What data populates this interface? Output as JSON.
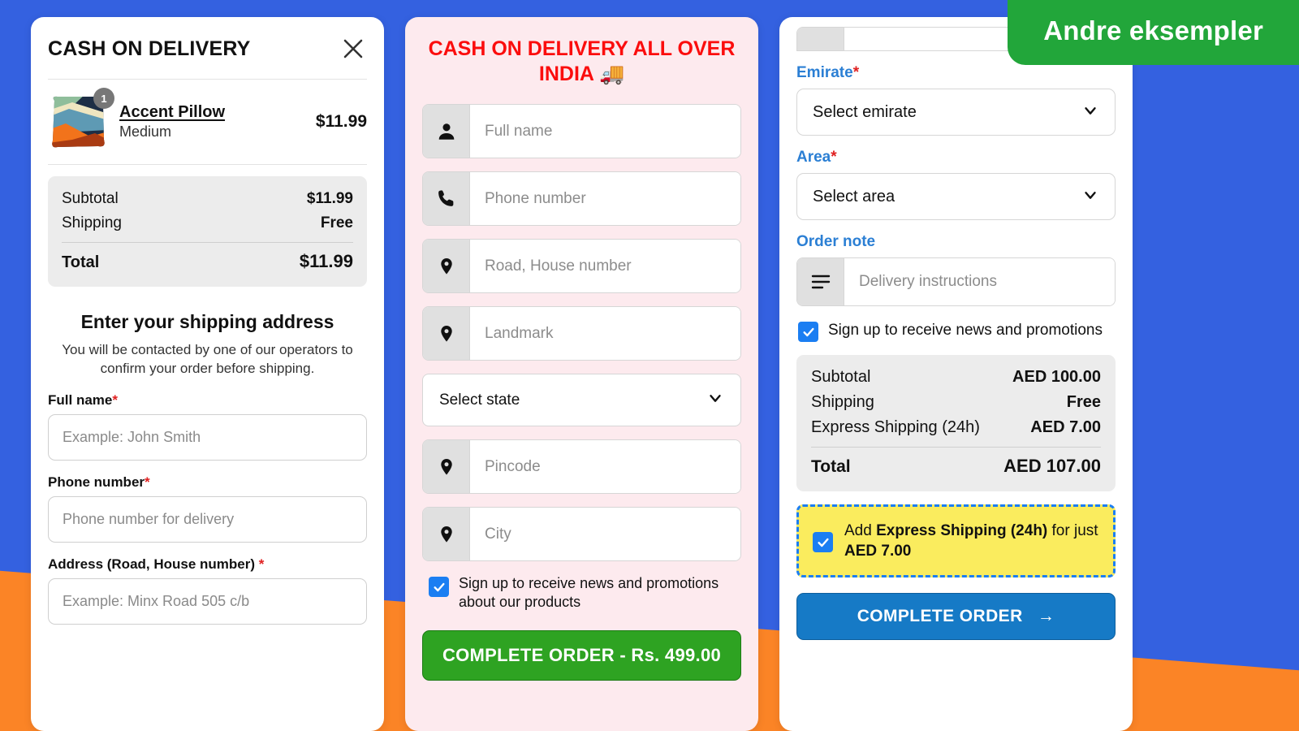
{
  "badge": {
    "label": "Andre eksempler"
  },
  "card1": {
    "title": "CASH ON DELIVERY",
    "close_icon": "close-icon",
    "line_item": {
      "qty": "1",
      "name": "Accent Pillow",
      "variant": "Medium",
      "price": "$11.99"
    },
    "summary": {
      "rows": [
        {
          "label": "Subtotal",
          "value": "$11.99"
        },
        {
          "label": "Shipping",
          "value": "Free"
        }
      ],
      "total_label": "Total",
      "total_value": "$11.99"
    },
    "shipping_heading": "Enter your shipping address",
    "shipping_note": "You will be contacted by one of our operators to confirm your order before shipping.",
    "fields": [
      {
        "label": "Full name",
        "required": "*",
        "placeholder": "Example: John Smith",
        "value": ""
      },
      {
        "label": "Phone number",
        "required": "*",
        "placeholder": "Phone number for delivery",
        "value": ""
      },
      {
        "label": "Address (Road, House number)",
        "required": "*",
        "placeholder": "Example: Minx Road 505 c/b",
        "value": ""
      }
    ]
  },
  "card2": {
    "title": "CASH ON DELIVERY ALL OVER INDIA 🚚",
    "fields": [
      {
        "icon": "person-icon",
        "placeholder": "Full name",
        "value": ""
      },
      {
        "icon": "phone-icon",
        "placeholder": "Phone number",
        "value": ""
      },
      {
        "icon": "map-pin-icon",
        "placeholder": "Road, House number",
        "value": ""
      },
      {
        "icon": "map-pin-icon",
        "placeholder": "Landmark",
        "value": ""
      }
    ],
    "state_select": {
      "label": "Select state",
      "icon": "chevron-down-icon"
    },
    "fields2": [
      {
        "icon": "map-pin-icon",
        "placeholder": "Pincode",
        "value": ""
      },
      {
        "icon": "map-pin-icon",
        "placeholder": "City",
        "value": ""
      }
    ],
    "newsletter": {
      "checked": true,
      "label": "Sign up to receive news and promotions about our products"
    },
    "submit_label": "COMPLETE ORDER - Rs. 499.00"
  },
  "card3": {
    "emirate": {
      "label": "Emirate",
      "required": "*",
      "selected": "Select emirate",
      "icon": "chevron-down-icon"
    },
    "area": {
      "label": "Area",
      "required": "*",
      "selected": "Select area",
      "icon": "chevron-down-icon"
    },
    "order_note": {
      "label": "Order note",
      "icon": "list-icon",
      "placeholder": "Delivery instructions",
      "value": ""
    },
    "newsletter": {
      "checked": true,
      "label": "Sign up to receive news and promotions"
    },
    "summary": {
      "rows": [
        {
          "label": "Subtotal",
          "value": "AED 100.00"
        },
        {
          "label": "Shipping",
          "value": "Free"
        },
        {
          "label": "Express Shipping (24h)",
          "value": "AED 7.00"
        }
      ],
      "total_label": "Total",
      "total_value": "AED 107.00"
    },
    "express": {
      "checked": true,
      "prefix": "Add ",
      "bold1": "Express Shipping (24h)",
      "middle": " for just ",
      "bold2": "AED 7.00"
    },
    "submit_label": "COMPLETE ORDER",
    "submit_icon": "arrow-right-icon"
  },
  "colors": {
    "background_blue": "#3461e0",
    "background_orange": "#fb8426",
    "badge_green": "#22a63a",
    "card2_bg": "#fdeaee",
    "card2_title_red": "#fb0d0d",
    "card3_label_blue": "#2b7fd4",
    "checkbox_blue": "#1b7ef2",
    "express_yellow": "#faec5e",
    "btn_green": "#2ea322",
    "btn_blue": "#167ac6",
    "required_red": "#e02020"
  }
}
